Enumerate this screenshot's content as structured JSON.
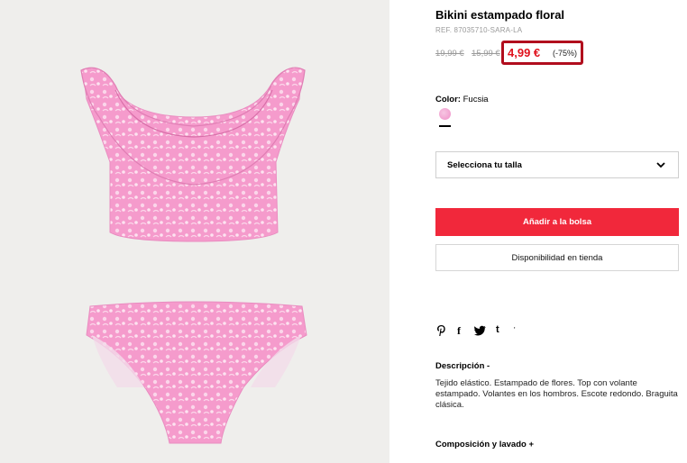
{
  "product": {
    "title": "Bikini estampado floral",
    "ref": "REF. 87035710-SARA-LA",
    "original_price": "19,99 €",
    "intermediate_price": "15,99 €",
    "current_price": "4,99 €",
    "discount": "(-75%)"
  },
  "color": {
    "label": "Color:",
    "value": "Fucsia",
    "swatch_color": "#f29ccf"
  },
  "size_select": {
    "label": "Selecciona tu talla",
    "icon": "chevron-down-icon"
  },
  "actions": {
    "add_to_bag": "Añadir a la bolsa",
    "store_availability": "Disponibilidad en tienda"
  },
  "share": {
    "icons": [
      "pinterest-icon",
      "facebook-icon",
      "twitter-icon",
      "tumblr-icon",
      "more-icon"
    ],
    "tumblr_label": "t",
    "facebook_label": "f",
    "more_label": "'"
  },
  "description": {
    "heading": "Descripción -",
    "text": "Tejido elástico. Estampado de flores. Top con volante estampado. Volantes en los hombros. Escote redondo. Braguita clásica."
  },
  "composition": {
    "heading": "Composición y lavado +"
  },
  "colors": {
    "accent_red": "#f1283b",
    "price_red": "#e0121d",
    "highlight_border": "#b10d1d",
    "bikini_pink": "#f59bcc"
  }
}
